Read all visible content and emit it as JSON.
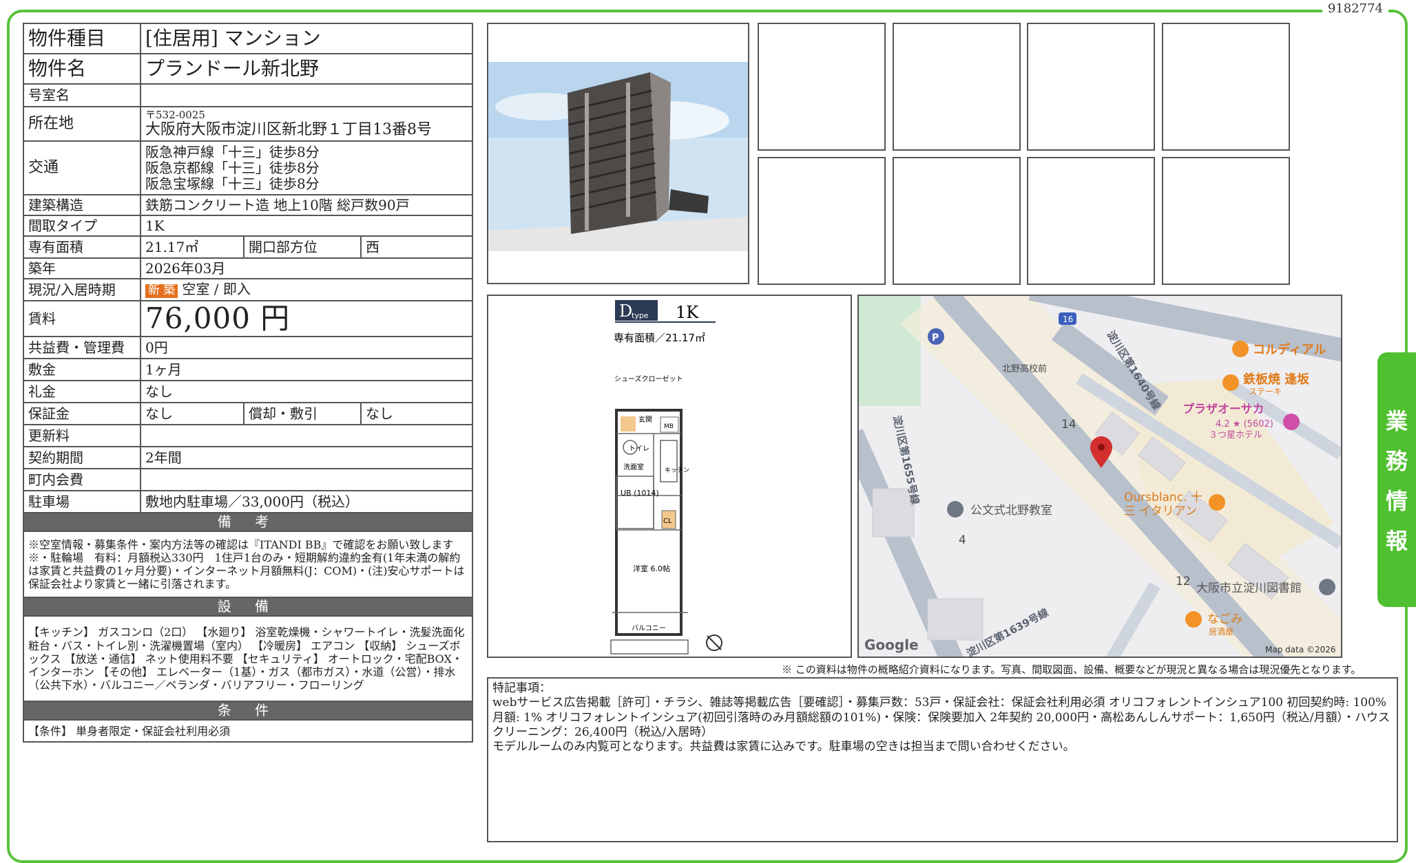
{
  "doc_id": "9182774",
  "side_tab": [
    "業",
    "務",
    "情",
    "報"
  ],
  "property": {
    "type_label": "物件種目",
    "type_value": "[住居用]  マンション",
    "name_label": "物件名",
    "name_value": "プランドール新北野",
    "room_label": "号室名",
    "room_value": "",
    "address_label": "所在地",
    "postal": "〒532-0025",
    "address": "大阪府大阪市淀川区新北野１丁目13番8号",
    "access_label": "交通",
    "access": [
      "阪急神戸線「十三」徒歩8分",
      "阪急京都線「十三」徒歩8分",
      "阪急宝塚線「十三」徒歩8分"
    ],
    "structure_label": "建築構造",
    "structure_value": "鉄筋コンクリート造 地上10階 総戸数90戸",
    "layout_label": "間取タイプ",
    "layout_value": "1K",
    "area_label": "専有面積",
    "area_value": "21.17㎡",
    "direction_label": "開口部方位",
    "direction_value": "西",
    "built_label": "築年",
    "built_value": "2026年03月",
    "status_label": "現況/入居時期",
    "status_badge": "新 築",
    "status_value": "空室 / 即入",
    "rent_label": "賃料",
    "rent_value": "76,000 円",
    "fee_label": "共益費・管理費",
    "fee_value": "0円",
    "deposit_label": "敷金",
    "deposit_value": "1ヶ月",
    "key_label": "礼金",
    "key_value": "なし",
    "guarantee_label": "保証金",
    "guarantee_value": "なし",
    "amort_label": "償却・敷引",
    "amort_value": "なし",
    "renewal_label": "更新料",
    "renewal_value": "",
    "contract_label": "契約期間",
    "contract_value": "2年間",
    "town_label": "町内会費",
    "town_value": "",
    "parking_label": "駐車場",
    "parking_value": "敷地内駐車場／33,000円（税込）"
  },
  "remarks": {
    "title": "備 考",
    "text": "※空室情報・募集条件・案内方法等の確認は『ITANDI BB』で確認をお願い致します※・駐輪場　有料：月額税込330円　1住戸1台のみ・短期解約違約金有(1年未満の解約は家賃と共益費の1ヶ月分要)・インターネット月額無料(J：COM)・(注)安心サポートは保証会社より家賃と一緒に引落されます。"
  },
  "equipment": {
    "title": "設 備",
    "text": "【キッチン】 ガスコンロ（2口） 【水廻り】 浴室乾燥機・シャワートイレ・洗髪洗面化粧台・バス・トイレ別・洗濯機置場（室内） 【冷暖房】 エアコン 【収納】 シューズボックス 【放送・通信】 ネット使用料不要 【セキュリティ】 オートロック・宅配BOX・インターホン 【その他】 エレベーター（1基）・ガス（都市ガス）・水道（公営）・排水（公共下水）・バルコニー／ベランダ・バリアフリー・フローリング"
  },
  "conditions": {
    "title": "条 件",
    "text": "【条件】 単身者限定・保証会社利用必須"
  },
  "floorplan": {
    "type_tag": "D",
    "type_sub": "type",
    "layout": "1K",
    "area_text": "専有面積／21.17㎡",
    "labels": [
      "シューズクローゼット",
      "玄関",
      "MB",
      "トイレ",
      "洗面室",
      "キッチン",
      "UB (1014)",
      "CL",
      "洋室 6.0帖",
      "バルコニー"
    ]
  },
  "map": {
    "labels": {
      "cordial": "コルディアル",
      "teppan": "鉄板焼 逢坂",
      "teppan_sub": "ステーキ",
      "plaza": "プラザオーサカ",
      "plaza_rating": "4.2 ★ (5602)",
      "plaza_sub": "３つ星ホテル",
      "school": "北野高校前",
      "kumon": "公文式北野教室",
      "ours": "Oursblanc. 十",
      "ours_sub": "三 イタリアン",
      "library": "大阪市立淀川図書館",
      "nagomi": "なごみ",
      "nagomi_sub": "居酒屋",
      "road1": "淀川区第1640号線",
      "road2": "淀川区第1655号線",
      "road3": "淀川区第1639号線",
      "route": "16",
      "num14": "14",
      "num4": "4",
      "num12": "12",
      "google": "Google",
      "mapdata": "Map data ©2026"
    }
  },
  "disclaimer": "※ この資料は物件の概略紹介資料になります。写真、間取図面、設備、概要などが現況と異なる場合は現況優先となります。",
  "special_notes": [
    "特記事項：",
    "webサービス広告掲載［許可］・チラシ、雑誌等掲載広告［要確認］・募集戸数：53戸・保証会社：保証会社利用必須 オリコフォレントインシュア100 初回契約時: 100% 月額: 1% オリコフォレントインシュア(初回引落時のみ月額総額の101%)・保険：保険要加入 2年契約 20,000円・高松あんしんサポート：1,650円（税込/月額）・ハウスクリーニング：26,400円（税込/入居時）",
    "モデルルームのみ内覧可となります。共益費は家賃に込みです。駐車場の空きは担当まで問い合わせください。"
  ],
  "colors": {
    "frame": "#57c23a",
    "tab": "#4fc02f",
    "badge": "#e4701e",
    "section": "#666666",
    "pin": "#d32f2f"
  }
}
